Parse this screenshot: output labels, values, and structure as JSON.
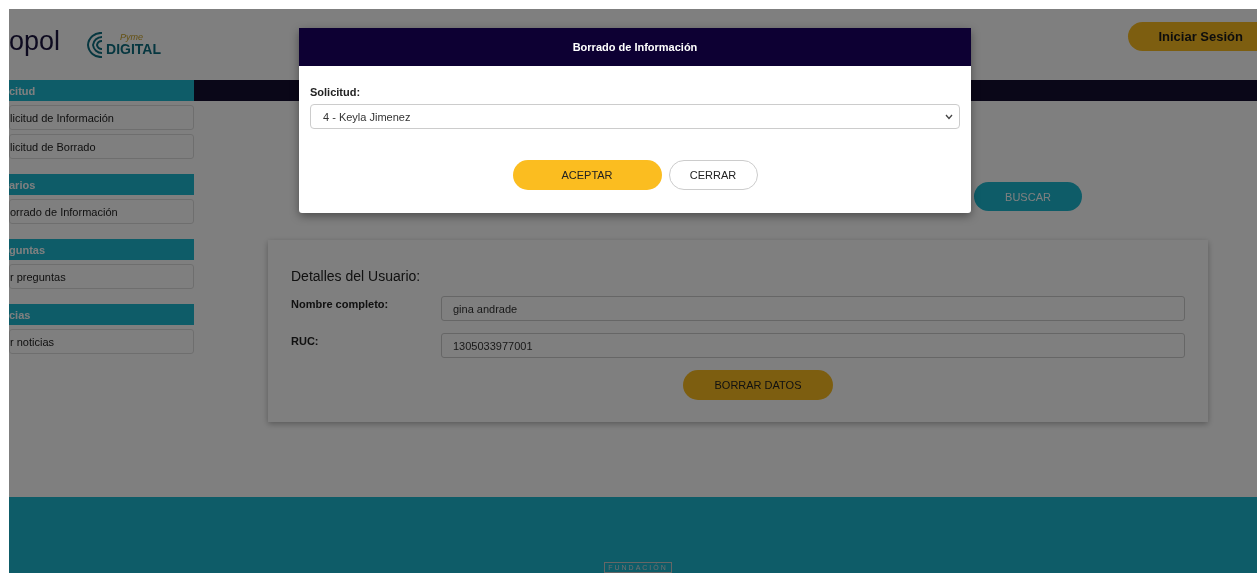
{
  "header": {
    "logo_text": "opol",
    "logo2_script": "Pyme",
    "logo2_text": "DIGITAL",
    "login_button": "Iniciar Sesión"
  },
  "sidebar": [
    {
      "title": "citud",
      "items": [
        "licitud de Información",
        "licitud de Borrado"
      ]
    },
    {
      "title": "arios",
      "items": [
        "orrado de Información"
      ]
    },
    {
      "title": "guntas",
      "items": [
        "r preguntas"
      ]
    },
    {
      "title": "cias",
      "items": [
        "r noticias"
      ]
    }
  ],
  "search_button": "BUSCAR",
  "details": {
    "title": "Detalles del Usuario:",
    "fields": [
      {
        "label": "Nombre completo:",
        "value": "gina andrade"
      },
      {
        "label": "RUC:",
        "value": "1305033977001"
      }
    ],
    "button": "BORRAR DATOS"
  },
  "footer": {
    "text": "FUNDACIÓN"
  },
  "modal": {
    "title": "Borrado de Información",
    "field_label": "Solicitud:",
    "selected_option": "4 - Keyla Jimenez",
    "buttons": [
      {
        "label": "ACEPTAR",
        "kind": "primary"
      },
      {
        "label": "CERRAR",
        "kind": "secondary"
      }
    ]
  }
}
